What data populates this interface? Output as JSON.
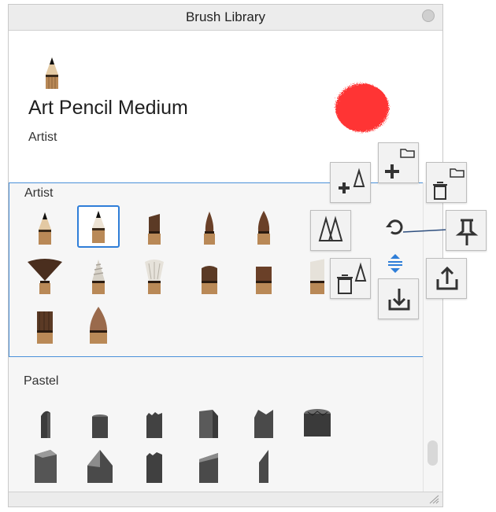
{
  "window": {
    "title": "Brush Library"
  },
  "current_brush": {
    "name": "Art Pencil Medium",
    "category": "Artist",
    "icon": "art-pencil-icon",
    "stroke_color": "#ff2b2b"
  },
  "sections": [
    {
      "title": "Artist",
      "brushes": [
        "pencil",
        "pencil-selected",
        "flat-brush",
        "round-brush",
        "pointed-brush",
        "brush-partial",
        "fan-brush",
        "swirl-brush",
        "shaving-brush",
        "flat-wide-brush",
        "flat-square-brush",
        "brush-partial-2",
        "flat-dry-brush",
        "filbert-brush"
      ]
    },
    {
      "title": "Pastel",
      "brushes": [
        "pastel-hard",
        "pastel-round",
        "pastel-rough",
        "pastel-angled",
        "pastel-broken",
        "pastel-chunky",
        "pastel-large-angled",
        "pastel-cone",
        "pastel-rough-2",
        "pastel-slanted",
        "pastel-thin"
      ]
    }
  ],
  "tools": [
    {
      "name": "new-brush-icon"
    },
    {
      "name": "new-set-icon"
    },
    {
      "name": "delete-set-icon"
    },
    {
      "name": "duplicate-brush-icon"
    },
    {
      "name": "reset-icon"
    },
    {
      "name": "pin-icon"
    },
    {
      "name": "delete-brush-icon"
    },
    {
      "name": "collapse-icon"
    },
    {
      "name": "share-icon"
    },
    {
      "name": "import-icon"
    }
  ]
}
